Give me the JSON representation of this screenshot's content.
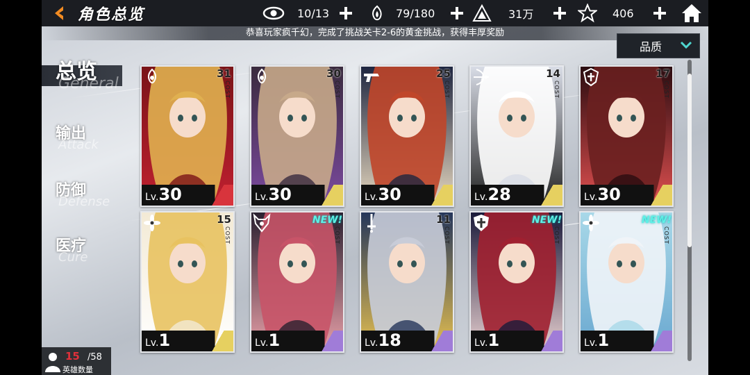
{
  "header": {
    "title": "角色总览",
    "resources": [
      {
        "icon": "eye-icon",
        "value": "10/13"
      },
      {
        "icon": "flame-hand-icon",
        "value": "79/180"
      },
      {
        "icon": "triangle-emblem-icon",
        "value": "31万"
      },
      {
        "icon": "star-icon",
        "value": "406"
      }
    ]
  },
  "notice": "恭喜玩家疯千幻，完成了挑战关卡2-6的黄金挑战，获得丰厚奖励",
  "sort": {
    "selected": "品质"
  },
  "tabs": [
    {
      "cn": "总览",
      "en": "General"
    },
    {
      "cn": "输出",
      "en": "Attack"
    },
    {
      "cn": "防御",
      "en": "Defense"
    },
    {
      "cn": "医疗",
      "en": "Cure"
    }
  ],
  "cost_label": "COST",
  "level_prefix": "Lv.",
  "cards": [
    {
      "cost": "31",
      "level": "30",
      "class_icon": "flame-emblem-icon",
      "new": false,
      "palette": [
        "#7a1418",
        "#e0b050",
        "#c02030"
      ],
      "stripe": "#d8343c"
    },
    {
      "cost": "30",
      "level": "30",
      "class_icon": "flame-emblem-icon",
      "new": false,
      "palette": [
        "#3a2b3e",
        "#c7a98a",
        "#7c4aa0"
      ],
      "stripe": "#e6d060"
    },
    {
      "cost": "25",
      "level": "30",
      "class_icon": "pistol-icon",
      "new": false,
      "palette": [
        "#1e2640",
        "#c0462a",
        "#e8d9c0"
      ],
      "stripe": "#e6d060"
    },
    {
      "cost": "14",
      "level": "28",
      "class_icon": "bow-icon",
      "new": false,
      "palette": [
        "#d8dce6",
        "#ffffff",
        "#222"
      ],
      "stripe": "#e6d060"
    },
    {
      "cost": "17",
      "level": "30",
      "class_icon": "shield-cross-emblem-icon",
      "new": false,
      "palette": [
        "#2a0c10",
        "#6a2020",
        "#e05050"
      ],
      "stripe": "#e6d060"
    },
    {
      "cost": "15",
      "level": "1",
      "class_icon": "lotus-emblem-icon",
      "new": false,
      "palette": [
        "#f3ead5",
        "#e8c260",
        "#ffffff"
      ],
      "stripe": "#e6d060"
    },
    {
      "cost": "",
      "level": "1",
      "class_icon": "horned-shield-icon",
      "new": true,
      "palette": [
        "#2a2030",
        "#c85468",
        "#e8a0a8"
      ],
      "stripe": "#a07cd8"
    },
    {
      "cost": "11",
      "level": "18",
      "class_icon": "sword-icon",
      "new": false,
      "palette": [
        "#25365a",
        "#c8ccd8",
        "#e6c050"
      ],
      "stripe": "#a07cd8"
    },
    {
      "cost": "",
      "level": "1",
      "class_icon": "cross-shield-icon",
      "new": true,
      "palette": [
        "#1a1a3a",
        "#a02030",
        "#e8d0d0"
      ],
      "stripe": "#a07cd8"
    },
    {
      "cost": "",
      "level": "1",
      "class_icon": "lotus-emblem-icon",
      "new": true,
      "palette": [
        "#a8d8e8",
        "#f0f4f8",
        "#6aa8d0"
      ],
      "stripe": "#a07cd8"
    }
  ],
  "new_label": "NEW!",
  "hero_count": {
    "current": "15",
    "max": "/58",
    "label": "英雄数量"
  }
}
